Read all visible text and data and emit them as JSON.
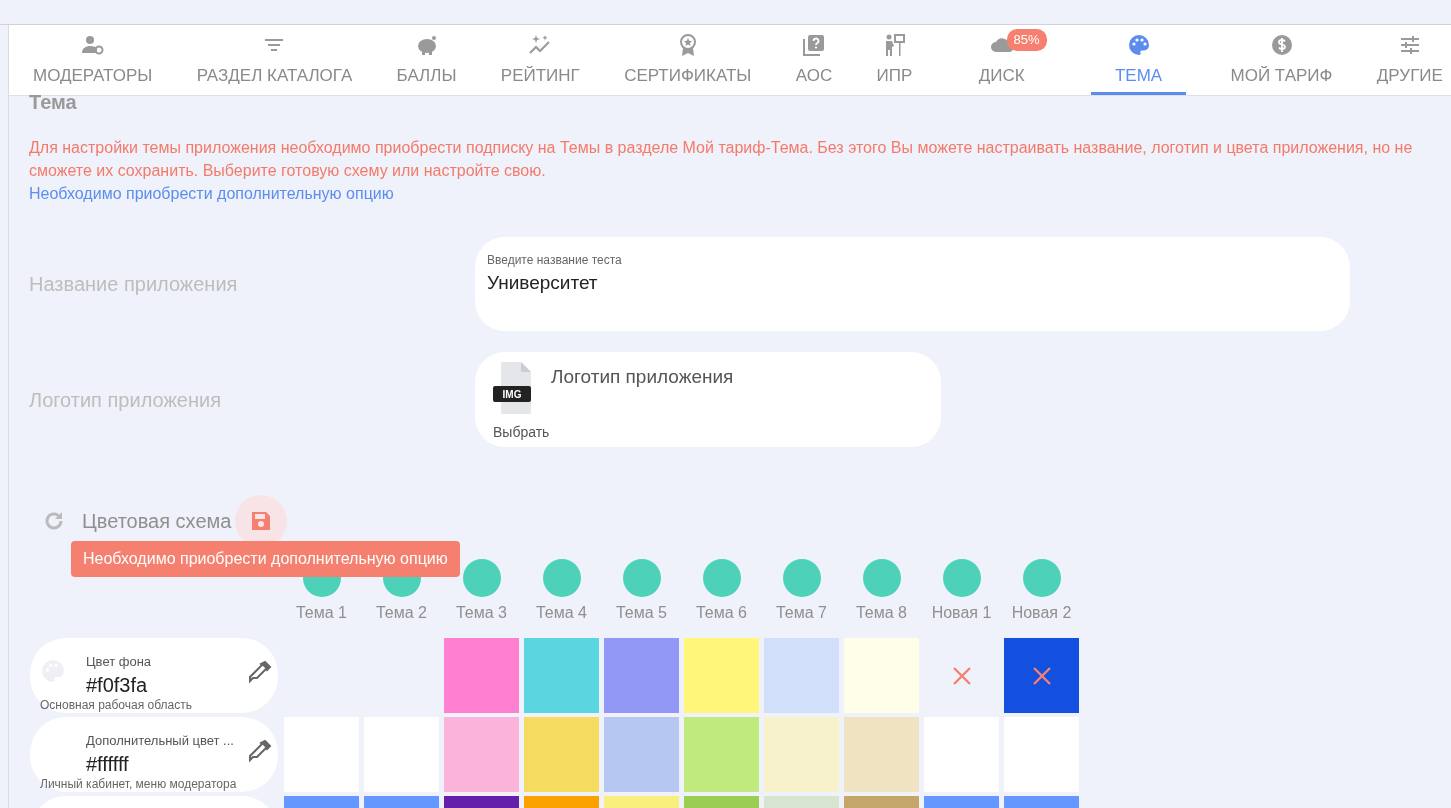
{
  "tabs": [
    {
      "label": "МОДЕРАТОРЫ",
      "selected": false
    },
    {
      "label": "РАЗДЕЛ КАТАЛОГА",
      "selected": false
    },
    {
      "label": "БАЛЛЫ",
      "selected": false
    },
    {
      "label": "РЕЙТИНГ",
      "selected": false
    },
    {
      "label": "СЕРТИФИКАТЫ",
      "selected": false
    },
    {
      "label": "АОС",
      "selected": false
    },
    {
      "label": "ИПР",
      "selected": false
    },
    {
      "label": "ДИСК",
      "selected": false,
      "badge": "85%"
    },
    {
      "label": "ТЕМА",
      "selected": true
    },
    {
      "label": "МОЙ ТАРИФ",
      "selected": false
    },
    {
      "label": "ДРУГИЕ",
      "selected": false
    }
  ],
  "heading": "Тема",
  "warning": "Для настройки темы приложения необходимо приобрести подписку на Темы в разделе Мой тариф-Тема. Без этого Вы можете настраивать название, логотип и цвета приложения, но не сможете их сохранить. Выберите готовую схему или настройте свою.",
  "purchase_link": "Необходимо приобрести дополнительную опцию",
  "app_name": {
    "label": "Название приложения",
    "floating_label": "Введите название теста",
    "value": "Университет"
  },
  "app_logo": {
    "label": "Логотип приложения",
    "file_badge": "IMG",
    "title": "Логотип приложения",
    "action": "Выбрать"
  },
  "color_scheme": {
    "title": "Цветовая схема",
    "tooltip": "Необходимо приобрести дополнительную опцию",
    "themes": [
      "Тема 1",
      "Тема 2",
      "Тема 3",
      "Тема 4",
      "Тема 5",
      "Тема 6",
      "Тема 7",
      "Тема 8",
      "Новая 1",
      "Новая 2"
    ],
    "rows": [
      {
        "label": "Цвет фона",
        "value": "#f0f3fa",
        "description": "Основная рабочая область",
        "palette_icon": true,
        "swatches": [
          {
            "kind": "empty"
          },
          {
            "kind": "empty"
          },
          {
            "kind": "color",
            "color": "#ff80d0"
          },
          {
            "kind": "color",
            "color": "#5ad6e0"
          },
          {
            "kind": "color",
            "color": "#9298f5"
          },
          {
            "kind": "color",
            "color": "#fff67a"
          },
          {
            "kind": "color",
            "color": "#d2dffa"
          },
          {
            "kind": "color",
            "color": "#fffee8"
          },
          {
            "kind": "removable"
          },
          {
            "kind": "removable",
            "color": "#1450e0"
          }
        ]
      },
      {
        "label": "Дополнительный цвет ...",
        "value": "#ffffff",
        "description": "Личный кабинет, меню модератора",
        "palette_icon": false,
        "swatches": [
          {
            "kind": "color",
            "color": "#ffffff"
          },
          {
            "kind": "color",
            "color": "#ffffff"
          },
          {
            "kind": "color",
            "color": "#fbb3d9"
          },
          {
            "kind": "color",
            "color": "#f5dc60"
          },
          {
            "kind": "color",
            "color": "#b6c8f2"
          },
          {
            "kind": "color",
            "color": "#c0ea7b"
          },
          {
            "kind": "color",
            "color": "#f7f2cc"
          },
          {
            "kind": "color",
            "color": "#f0e3c2"
          },
          {
            "kind": "color",
            "color": "#ffffff"
          },
          {
            "kind": "color",
            "color": "#ffffff"
          }
        ]
      },
      {
        "swatches": [
          {
            "kind": "color",
            "color": "#6497ff"
          },
          {
            "kind": "color",
            "color": "#6497ff"
          },
          {
            "kind": "color",
            "color": "#6420a8"
          },
          {
            "kind": "color",
            "color": "#fba100"
          },
          {
            "kind": "color",
            "color": "#f9ef7c"
          },
          {
            "kind": "color",
            "color": "#9acd52"
          },
          {
            "kind": "color",
            "color": "#d7e5d0"
          },
          {
            "kind": "color",
            "color": "#c4a66a"
          },
          {
            "kind": "color",
            "color": "#6497ff"
          },
          {
            "kind": "color",
            "color": "#6497ff"
          }
        ]
      }
    ]
  }
}
